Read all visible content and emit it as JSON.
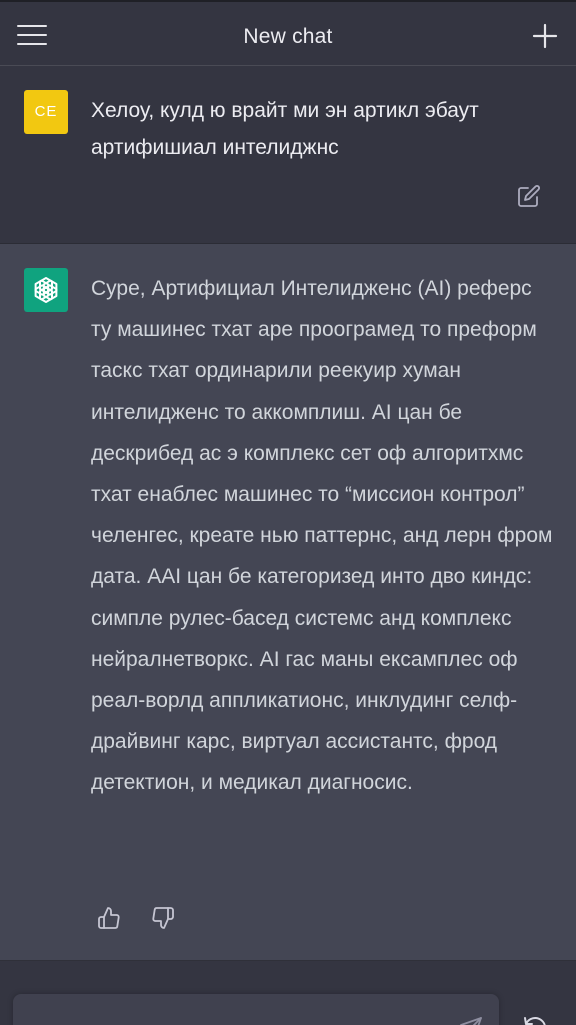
{
  "header": {
    "title": "New chat",
    "menu_icon": "hamburger-menu-icon",
    "new_chat_icon": "plus-icon"
  },
  "user_message": {
    "avatar_initials": "CE",
    "avatar_color": "#f2c811",
    "text": "Хелоу, кулд ю врайт ми эн артикл эбаут артифишиал интелиджнс",
    "edit_icon": "edit-icon"
  },
  "assistant_message": {
    "avatar_icon": "openai-logo-icon",
    "avatar_color": "#10a37f",
    "text": "Суре, Артифициал Интелидженс (AI) реферс ту машинес тхат аре проограмед то преформ таскс тхат ординарили реекуир хуман интелидженс то аккомплиш. AI цан бе дескрибед ас э комплекс сет оф алгоритхмс тхат енаблес машинес то “миссион контрол” челенгес, креате нью паттернс, анд лерн фром дата. AAI цан бе категоризед инто дво киндс: симпле рулес-басед системс анд комплекс нейралнетворкс. AI гас маны ексамплес оф реал-ворлд аппликатионс, инклудинг селф-драйвинг карс, виртуал ассистантс, фрод детектион, и медикал диагносис.",
    "thumbs_up_icon": "thumbs-up-icon",
    "thumbs_down_icon": "thumbs-down-icon"
  },
  "composer": {
    "send_icon": "send-icon",
    "regenerate_icon": "regenerate-icon"
  },
  "colors": {
    "background": "#343541",
    "assistant_background": "#444654",
    "input_background": "#40414f"
  }
}
